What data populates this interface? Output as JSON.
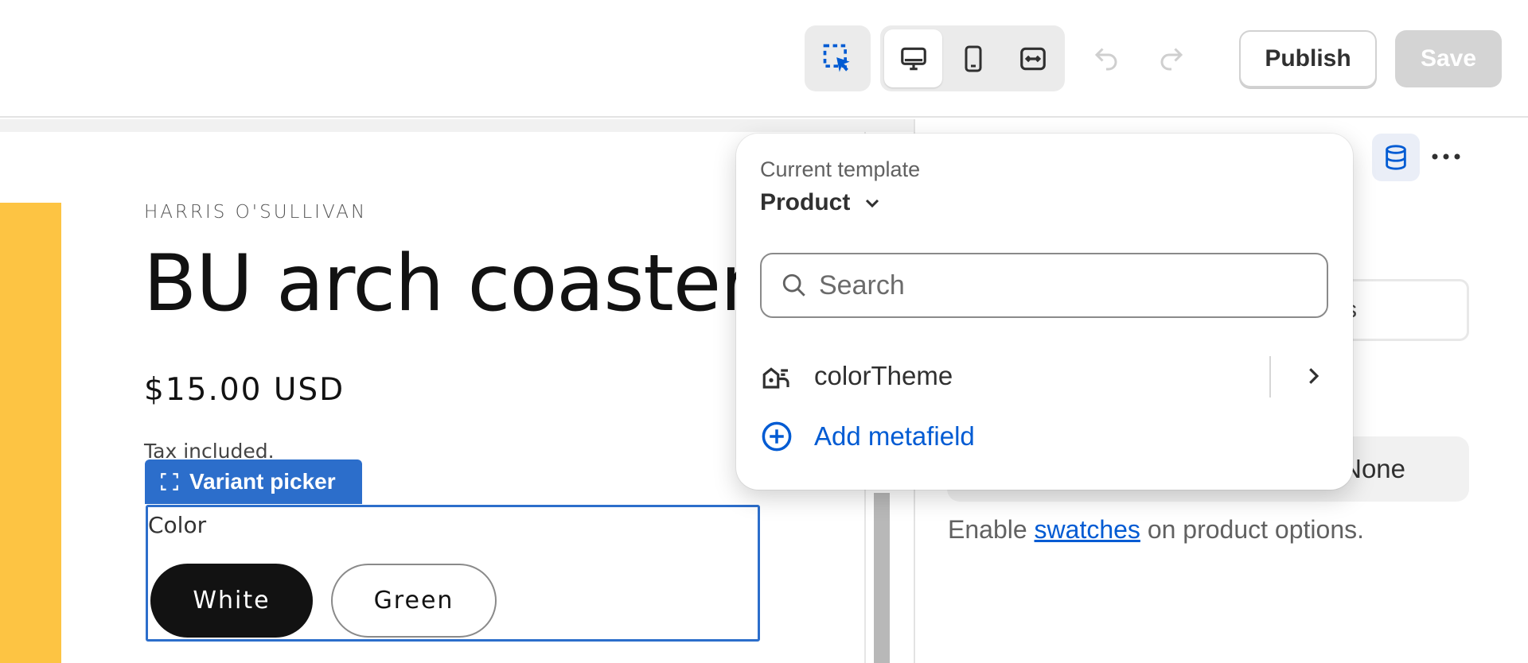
{
  "toolbar": {
    "select_icon": "cursor-select-icon",
    "views": [
      "desktop-icon",
      "mobile-icon",
      "fullwidth-icon"
    ],
    "undo_icon": "undo-icon",
    "redo_icon": "redo-icon",
    "publish_label": "Publish",
    "save_label": "Save"
  },
  "preview": {
    "vendor": "HARRIS O'SULLIVAN",
    "title": "BU arch coaster",
    "price": "$15.00 USD",
    "tax_note": "Tax included.",
    "variant_picker_tab": "Variant picker",
    "option_label": "Color",
    "swatches": [
      "White",
      "Green"
    ]
  },
  "popover": {
    "label": "Current template",
    "template": "Product",
    "search_placeholder": "Search",
    "item_label": "colorTheme",
    "add_label": "Add metafield"
  },
  "side_panel": {
    "peek_input_text": "s",
    "segment_none_label": "None",
    "helper_prefix": "Enable ",
    "helper_link": "swatches",
    "helper_suffix": " on product options."
  },
  "colors": {
    "accent": "#2c6ecb",
    "link": "#005bd3",
    "image_yellow": "#fdc443"
  }
}
